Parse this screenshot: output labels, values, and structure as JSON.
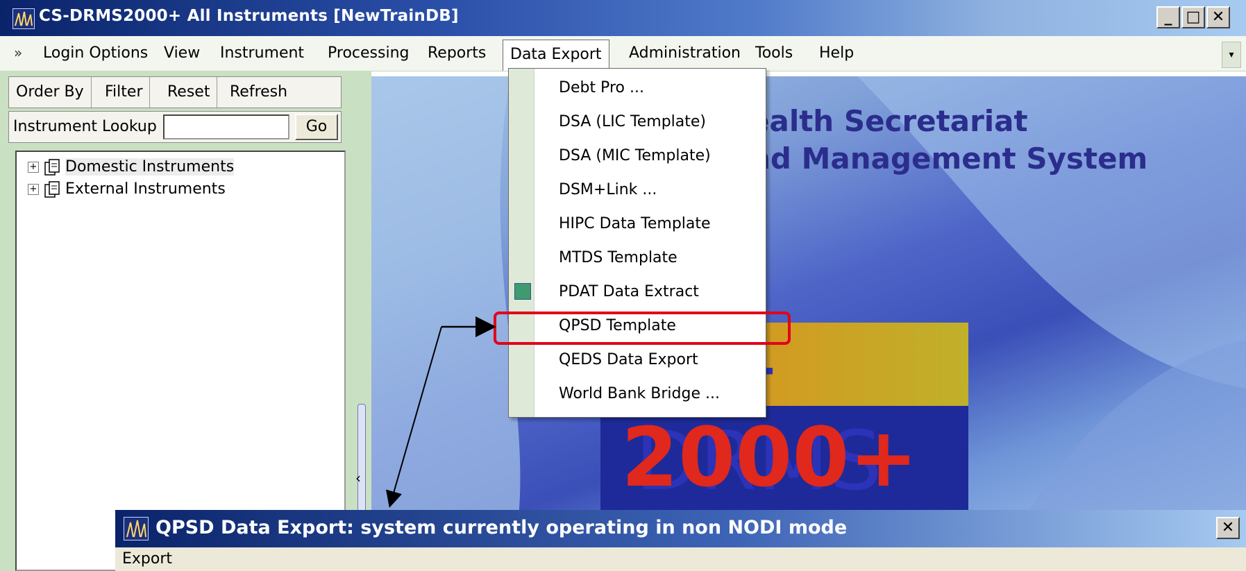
{
  "window": {
    "title": "CS-DRMS2000+ All Instruments [NewTrainDB]",
    "min_glyph": "_",
    "max_glyph": "□",
    "close_glyph": "✕"
  },
  "menubar": {
    "chevron": "»",
    "items": [
      "Login Options",
      "View",
      "Instrument",
      "Processing",
      "Reports",
      "Data Export",
      "Administration",
      "Tools",
      "Help"
    ],
    "active": "Data Export",
    "overflow_glyph": "▾"
  },
  "toolbar": {
    "buttons": [
      "Order By",
      "Filter",
      "Reset",
      "Refresh"
    ]
  },
  "lookup": {
    "label": "Instrument Lookup",
    "value": "",
    "go_label": "Go"
  },
  "tree": {
    "items": [
      {
        "label": "Domestic Instruments",
        "expander": "+"
      },
      {
        "label": "External Instruments",
        "expander": "+"
      }
    ]
  },
  "splitter": {
    "arrow": "‹"
  },
  "splash": {
    "line1": "ealth Secretariat",
    "line2": "nd Management System",
    "logo_name": "CS-DRMS",
    "logo_year": "2000+"
  },
  "dropdown": {
    "items": [
      "Debt Pro ...",
      "DSA (LIC Template)",
      "DSA (MIC Template)",
      "DSM+Link ...",
      "HIPC Data Template",
      "MTDS Template",
      "PDAT Data Extract",
      "QPSD Template",
      "QEDS Data Export",
      "World Bank Bridge ..."
    ],
    "highlighted": "QPSD Template"
  },
  "dialog": {
    "title": "QPSD Data Export: system currently operating in non NODI mode",
    "close_glyph": "✕",
    "group_label": "Export"
  },
  "colors": {
    "titlebar": "#0a246a",
    "menubar": "#f2f6ef",
    "panel": "#c9e0c2",
    "highlight_border": "#e2001a",
    "splash_text": "#2b2d8c"
  }
}
